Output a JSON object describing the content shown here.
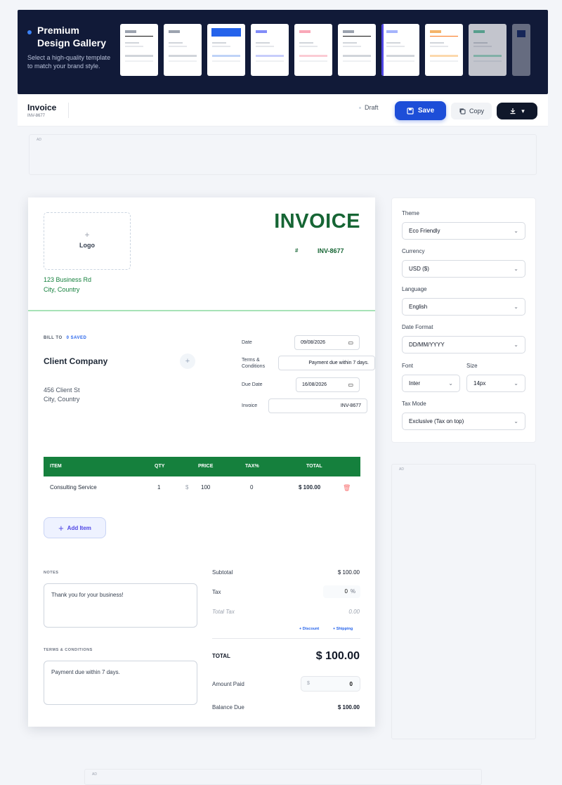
{
  "gallery": {
    "title_line1": "Premium",
    "title_line2": "Design Gallery",
    "subtitle": "Select a high-quality template to match your brand style."
  },
  "header": {
    "doc_title": "Invoice",
    "doc_id": "INV-8677",
    "draft_label": "Draft",
    "save_label": "Save",
    "copy_label": "Copy",
    "download_icon": "download-icon"
  },
  "ads": {
    "label": "AD"
  },
  "invoice": {
    "logo_label": "Logo",
    "business_address_line1": "123 Business Rd",
    "business_address_line2": "City, Country",
    "title": "INVOICE",
    "number_prefix": "#",
    "number": "INV-8677",
    "bill_to_label": "BILL TO",
    "saved_label": "0 SAVED",
    "client_name": "Client Company",
    "client_address_line1": "456 Client St",
    "client_address_line2": "City, Country",
    "meta": {
      "date_label": "Date",
      "date_value": "09/08/2026",
      "terms_label_line1": "Terms &",
      "terms_label_line2": "Conditions",
      "terms_value": "Payment due within 7 days.",
      "due_date_label": "Due Date",
      "due_date_value": "16/08/2026",
      "invoice_label": "Invoice",
      "invoice_value": "INV-8677"
    },
    "table": {
      "headers": [
        "ITEM",
        "QTY",
        "PRICE",
        "TAX%",
        "TOTAL"
      ],
      "rows": [
        {
          "item": "Consulting Service",
          "qty": "1",
          "currency": "$",
          "price": "100",
          "tax": "0",
          "total": "$ 100.00"
        }
      ]
    },
    "add_item_label": "Add Item",
    "notes_label": "NOTES",
    "notes_value": "Thank you for your business!",
    "terms_section_label": "TERMS & CONDITIONS",
    "terms_section_value": "Payment due within 7 days.",
    "summary": {
      "subtotal_label": "Subtotal",
      "subtotal_value": "$ 100.00",
      "tax_label": "Tax",
      "tax_value": "0",
      "tax_unit": "%",
      "total_tax_label": "Total Tax",
      "total_tax_value": "0.00",
      "discount_link": "+ Discount",
      "shipping_link": "+ Shipping",
      "total_label": "TOTAL",
      "total_value": "$ 100.00",
      "amount_paid_label": "Amount Paid",
      "amount_paid_currency": "$",
      "amount_paid_value": "0",
      "balance_due_label": "Balance Due",
      "balance_due_value": "$ 100.00"
    }
  },
  "settings": {
    "theme_label": "Theme",
    "theme_value": "Eco Friendly",
    "currency_label": "Currency",
    "currency_value": "USD ($)",
    "language_label": "Language",
    "language_value": "English",
    "date_format_label": "Date Format",
    "date_format_value": "DD/MM/YYYY",
    "font_label": "Font",
    "font_value": "Inter",
    "size_label": "Size",
    "size_value": "14px",
    "tax_mode_label": "Tax Mode",
    "tax_mode_value": "Exclusive (Tax on top)"
  },
  "colors": {
    "accent_green": "#15803d",
    "banner_navy": "#111a38",
    "save_blue": "#1d4ed8"
  }
}
